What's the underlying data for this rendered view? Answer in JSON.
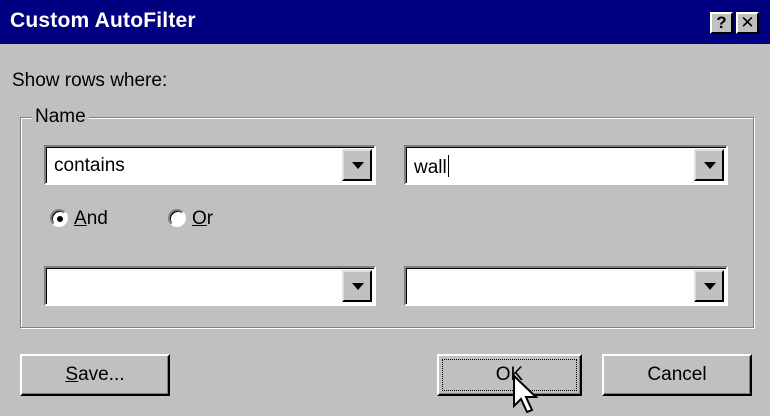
{
  "window": {
    "title": "Custom AutoFilter",
    "help_glyph": "?",
    "close_glyph": "✕"
  },
  "prompt": "Show rows where:",
  "group": {
    "label": "Name"
  },
  "criteria": [
    {
      "operator": "contains",
      "value": "wall"
    },
    {
      "operator": "",
      "value": ""
    }
  ],
  "logic": {
    "and": {
      "label_access": "A",
      "label_rest": "nd",
      "selected": true
    },
    "or": {
      "label_access": "O",
      "label_rest": "r",
      "selected": false
    }
  },
  "buttons": {
    "save_access": "S",
    "save_rest": "ave...",
    "ok": "OK",
    "cancel": "Cancel"
  },
  "colors": {
    "titlebar": "#000080",
    "face": "#c0c0c0"
  },
  "icons": {
    "dropdown": "chevron-down-icon",
    "cursor": "mouse-pointer-icon"
  }
}
